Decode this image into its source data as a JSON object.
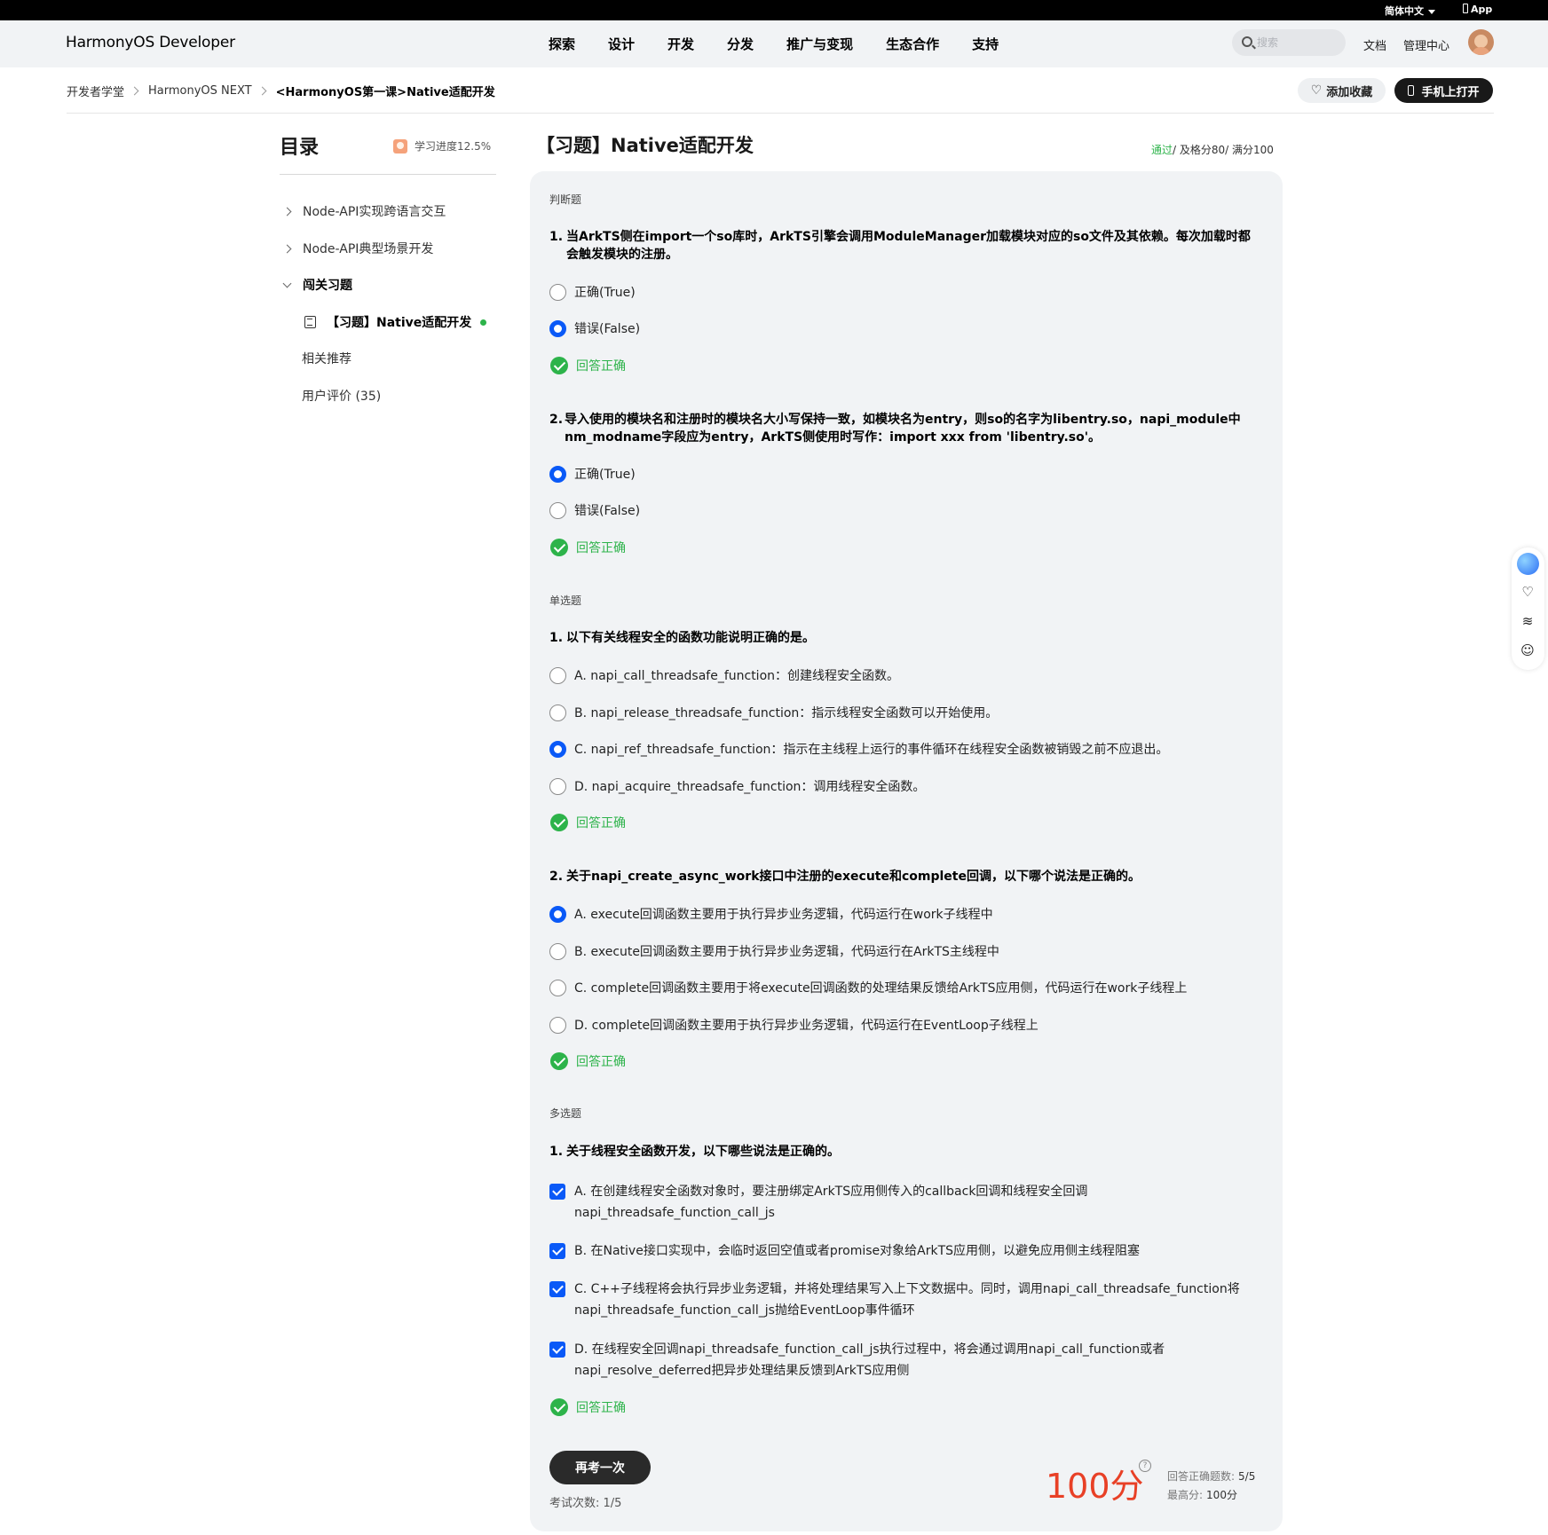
{
  "topbar": {
    "language": "简体中文",
    "app": "App"
  },
  "header": {
    "logo": "HarmonyOS Developer",
    "nav": [
      "探索",
      "设计",
      "开发",
      "分发",
      "推广与变现",
      "生态合作",
      "支持"
    ],
    "search_placeholder": "搜索",
    "docs": "文档",
    "console": "管理中心"
  },
  "breadcrumb": [
    "开发者学堂",
    "HarmonyOS NEXT",
    "<HarmonyOS第一课>Native适配开发"
  ],
  "actions": {
    "favorite": "添加收藏",
    "open_on_phone": "手机上打开"
  },
  "toc": {
    "title": "目录",
    "progress": "学习进度12.5%",
    "items": [
      "Node-API实现跨语言交互",
      "Node-API典型场景开发",
      "闯关习题",
      "【习题】Native适配开发",
      "相关推荐",
      "用户评价 (35)"
    ]
  },
  "quiz": {
    "title": "【习题】Native适配开发",
    "status_pass": "通过",
    "status_rest": "/ 及格分80/ 满分100",
    "correct_label": "回答正确",
    "sections": {
      "tf": "判断题",
      "single": "单选题",
      "multi": "多选题"
    },
    "tf_q1": {
      "num": "1.",
      "text": "当ArkTS侧在import一个so库时，ArkTS引擎会调用ModuleManager加载模块对应的so文件及其依赖。每次加载时都会触发模块的注册。",
      "options": [
        "正确(True)",
        "错误(False)"
      ]
    },
    "tf_q2": {
      "num": "2.",
      "text": "导入使用的模块名和注册时的模块名大小写保持一致，如模块名为entry，则so的名字为libentry.so，napi_module中nm_modname字段应为entry，ArkTS侧使用时写作：import xxx from 'libentry.so'。",
      "options": [
        "正确(True)",
        "错误(False)"
      ]
    },
    "single_q1": {
      "num": "1.",
      "text": "以下有关线程安全的函数功能说明正确的是。",
      "options": [
        "A. napi_call_threadsafe_function：创建线程安全函数。",
        "B. napi_release_threadsafe_function：指示线程安全函数可以开始使用。",
        "C. napi_ref_threadsafe_function：指示在主线程上运行的事件循环在线程安全函数被销毁之前不应退出。",
        "D. napi_acquire_threadsafe_function：调用线程安全函数。"
      ]
    },
    "single_q2": {
      "num": "2.",
      "text": "关于napi_create_async_work接口中注册的execute和complete回调，以下哪个说法是正确的。",
      "options": [
        "A. execute回调函数主要用于执行异步业务逻辑，代码运行在work子线程中",
        "B. execute回调函数主要用于执行异步业务逻辑，代码运行在ArkTS主线程中",
        "C. complete回调函数主要用于将execute回调函数的处理结果反馈给ArkTS应用侧，代码运行在work子线程上",
        "D. complete回调函数主要用于执行异步业务逻辑，代码运行在EventLoop子线程上"
      ]
    },
    "multi_q1": {
      "num": "1.",
      "text": "关于线程安全函数开发，以下哪些说法是正确的。",
      "options": [
        "A. 在创建线程安全函数对象时，要注册绑定ArkTS应用侧传入的callback回调和线程安全回调napi_threadsafe_function_call_js",
        "B. 在Native接口实现中，会临时返回空值或者promise对象给ArkTS应用侧，以避免应用侧主线程阻塞",
        "C. C++子线程将会执行异步业务逻辑，并将处理结果写入上下文数据中。同时，调用napi_call_threadsafe_function将napi_threadsafe_function_call_js抛给EventLoop事件循环",
        "D. 在线程安全回调napi_threadsafe_function_call_js执行过程中，将会通过调用napi_call_function或者napi_resolve_deferred把异步处理结果反馈到ArkTS应用侧"
      ]
    },
    "retry": "再考一次",
    "attempts": "考试次数: 1/5",
    "score": "100分",
    "correct_count_label": "回答正确题数:",
    "correct_count": "5/5",
    "best_label": "最高分:",
    "best": "100分"
  },
  "colors": {
    "primary": "#0a59f7",
    "success": "#2db34a",
    "score": "#e84026"
  }
}
